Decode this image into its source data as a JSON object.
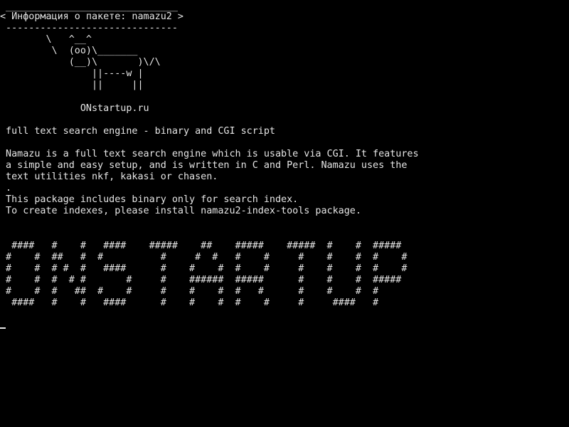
{
  "terminal": {
    "cowsay": {
      "border_top": " ______________________________",
      "bubble": "< Информация о пакете: namazu2 >",
      "border_bottom": " ------------------------------",
      "cow_1": "        \\   ^__^",
      "cow_2": "         \\  (oo)\\_______",
      "cow_3": "            (__)\\       )\\/\\",
      "cow_4": "                ||----w |",
      "cow_5": "                ||     ||",
      "site": "              ONstartup.ru"
    },
    "package": {
      "summary": " full text search engine - binary and CGI script",
      "desc_1": " Namazu is a full text search engine which is usable via CGI. It features",
      "desc_2": " a simple and easy setup, and is written in C and Perl. Namazu uses the",
      "desc_3": " text utilities nkf, kakasi or chasen.",
      "desc_4": " .",
      "desc_5": " This package includes binary only for search index.",
      "desc_6": " To create indexes, please install namazu2-index-tools package."
    },
    "banner": [
      "  ####   #    #   ####    #####    ##    #####    #####  #    #  #####",
      " #    #  ##   #  #          #     #  #   #    #     #    #    #  #    #",
      " #    #  # #  #   ####      #    #    #  #    #     #    #    #  #    #",
      " #    #  #  # #       #     #    ######  #####      #    #    #  #####",
      " #    #  #   ##  #    #     #    #    #  #   #      #    #    #  #",
      "  ####   #    #   ####      #    #    #  #    #     #     ####   #"
    ]
  }
}
